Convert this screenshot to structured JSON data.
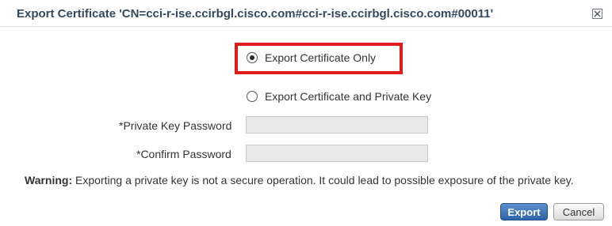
{
  "dialog": {
    "title": "Export Certificate 'CN=cci-r-ise.ccirbgl.cisco.com#cci-r-ise.ccirbgl.cisco.com#00011'"
  },
  "options": {
    "cert_only_label": "Export Certificate Only",
    "cert_and_key_label": "Export Certificate and Private Key",
    "selected": "cert_only"
  },
  "fields": {
    "private_key_password_label": "*Private Key Password",
    "confirm_password_label": "*Confirm Password",
    "private_key_password_value": "",
    "confirm_password_value": ""
  },
  "warning": {
    "prefix": "Warning:",
    "text": " Exporting a private key is not a secure operation. It could lead to possible exposure of the private key."
  },
  "buttons": {
    "export_label": "Export",
    "cancel_label": "Cancel"
  },
  "colors": {
    "highlight": "#e01b1b",
    "title": "#34495e",
    "primary_button": "#2f64a8"
  }
}
